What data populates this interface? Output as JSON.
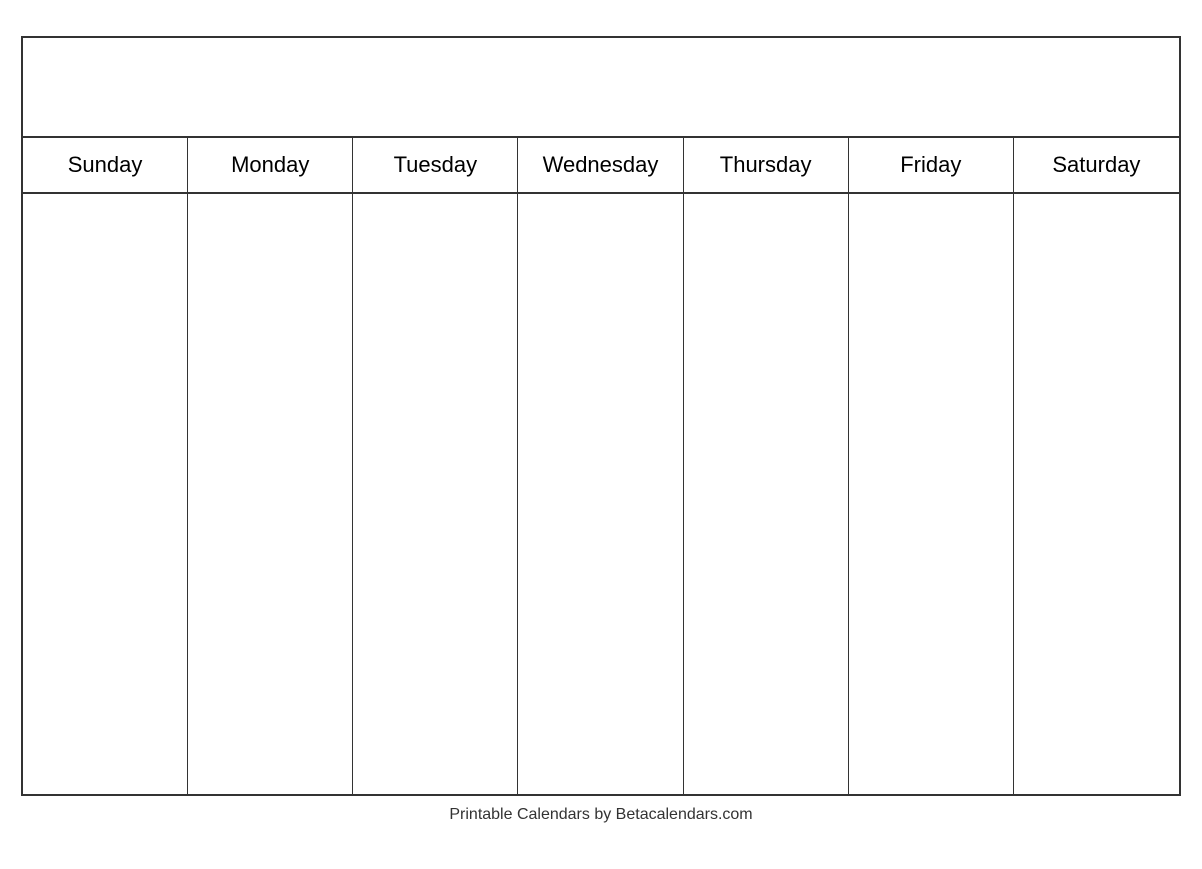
{
  "calendar": {
    "title": "",
    "days": [
      "Sunday",
      "Monday",
      "Tuesday",
      "Wednesday",
      "Thursday",
      "Friday",
      "Saturday"
    ],
    "rows": 5,
    "footer": "Printable Calendars by Betacalendars.com"
  }
}
